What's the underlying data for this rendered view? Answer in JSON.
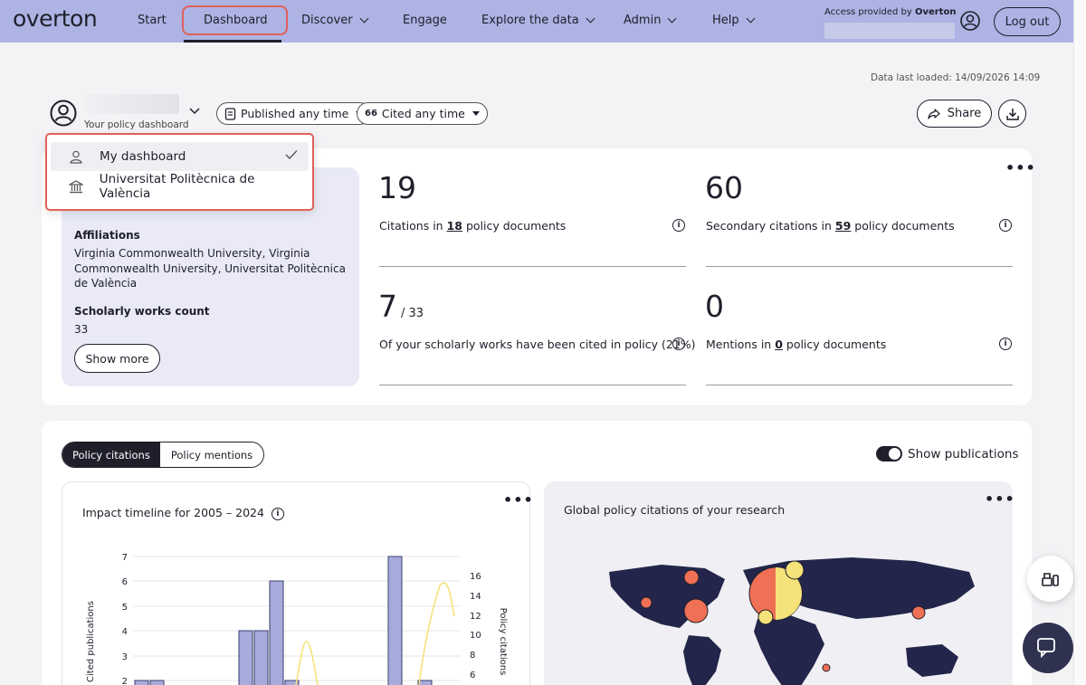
{
  "nav": {
    "logo": "overton",
    "items": [
      {
        "label": "Start",
        "dropdown": false
      },
      {
        "label": "Dashboard",
        "dropdown": false,
        "active": true
      },
      {
        "label": "Discover",
        "dropdown": true
      },
      {
        "label": "Engage",
        "dropdown": false
      },
      {
        "label": "Explore the data",
        "dropdown": true
      },
      {
        "label": "Admin",
        "dropdown": true
      },
      {
        "label": "Help",
        "dropdown": true
      }
    ],
    "access_prefix": "Access provided by",
    "access_org": "Overton",
    "logout": "Log out"
  },
  "header": {
    "data_loaded": "Data last loaded: 14/09/2026 14:09",
    "profile_sub": "Your policy dashboard",
    "filter_published": "Published any time",
    "filter_cited_icon": "66",
    "filter_cited": "Cited any time",
    "share": "Share"
  },
  "dropdown": {
    "items": [
      {
        "label": "My dashboard",
        "icon": "person-icon",
        "selected": true
      },
      {
        "label": "Universitat Politècnica de València",
        "icon": "institution-icon",
        "selected": false
      }
    ]
  },
  "profile": {
    "affiliations_label": "Affiliations",
    "affiliations": "Virginia Commonwealth University, Virginia Commonwealth University, Universitat Politècnica de València",
    "works_label": "Scholarly works count",
    "works_count": "33",
    "show_more": "Show more"
  },
  "metrics": {
    "citations": {
      "value": "19",
      "pre": "Citations in ",
      "link": "18",
      "post": " policy documents"
    },
    "secondary": {
      "value": "60",
      "pre": "Secondary citations in ",
      "link": "59",
      "post": " policy documents"
    },
    "works_cited": {
      "value": "7",
      "total": "/ 33",
      "desc": "Of your scholarly works have been cited in policy (21%)"
    },
    "mentions": {
      "value": "0",
      "pre": "Mentions in ",
      "link": "0",
      "post": " policy documents"
    }
  },
  "tabs": {
    "policy_citations": "Policy citations",
    "policy_mentions": "Policy mentions"
  },
  "toggle": {
    "label": "Show publications",
    "on": true
  },
  "timeline": {
    "title": "Impact timeline for 2005 – 2024",
    "y_left_label": "Cited publications",
    "y_right_label": "Policy citations",
    "left_ticks": [
      "7",
      "6",
      "5",
      "4",
      "3",
      "2"
    ],
    "right_ticks": [
      "16",
      "14",
      "12",
      "10",
      "8",
      "6"
    ]
  },
  "map": {
    "title": "Global policy citations of your research"
  },
  "colors": {
    "nav_bg": "#adb3e3",
    "accent_red": "#e0605a",
    "bar": "#a6abdc",
    "line": "#f5e27a",
    "dark": "#1e1f2b"
  }
}
